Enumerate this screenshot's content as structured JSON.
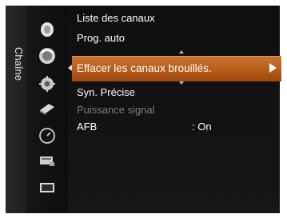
{
  "sidebar": {
    "title": "Chaîne"
  },
  "icons": [
    "picture-icon",
    "channel-icon",
    "setup-icon",
    "input-icon",
    "clock-icon",
    "function-icon",
    "screen-icon"
  ],
  "menu": {
    "items": [
      {
        "label": "Liste des canaux",
        "enabled": true
      },
      {
        "label": "Prog. auto",
        "enabled": true
      },
      {
        "label": "Effacer les canaux brouillés.",
        "enabled": true,
        "selected": true
      },
      {
        "label": "Syn. Précise",
        "enabled": true
      },
      {
        "label": "Puissance signal",
        "enabled": false
      },
      {
        "label": "AFB",
        "value": ": On",
        "enabled": true
      }
    ]
  },
  "colors": {
    "highlight": "#b55a18",
    "panel": "#111111",
    "text": "#ffffff",
    "disabled_text": "#7c7c7c"
  }
}
